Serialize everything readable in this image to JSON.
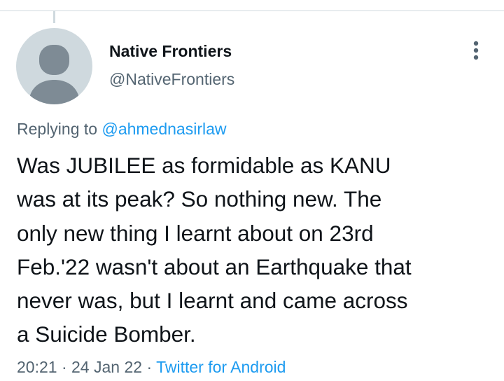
{
  "tweet": {
    "author": {
      "display_name": "Native Frontiers",
      "handle": "@NativeFrontiers",
      "avatar": "default-avatar-icon"
    },
    "more_icon": "more-vertical-icon",
    "replying_prefix": "Replying to",
    "replying_to": "@ahmednasirlaw",
    "text": "Was JUBILEE as formidable as KANU\nwas at its peak? So nothing new. The\nonly new thing I learnt about on 23rd\nFeb.'22 wasn't about an Earthquake that\nnever was, but I learnt and came across\na Suicide Bomber.",
    "time": "20:21",
    "date": "24 Jan 22",
    "separator": "·",
    "source": "Twitter for Android"
  },
  "colors": {
    "text_primary": "#0f1419",
    "text_secondary": "#536471",
    "accent": "#1d9bf0",
    "avatar_bg": "#cfd9de",
    "avatar_fg": "#7e8b95",
    "divider": "#cfd9de"
  }
}
